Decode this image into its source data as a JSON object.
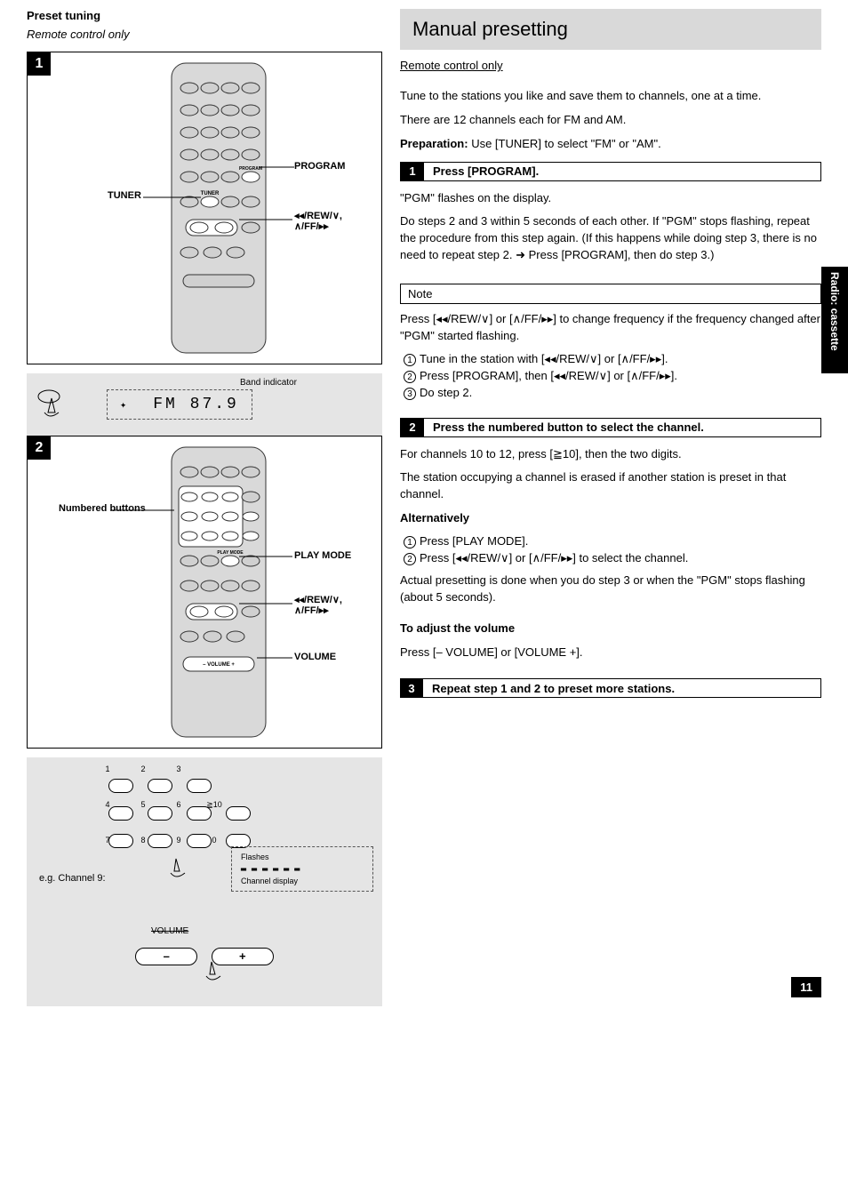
{
  "page_number": "11",
  "side_tab": "Radio: cassette",
  "left": {
    "title": "Preset tuning",
    "sub": "Remote control only",
    "step1": {
      "num": "1",
      "tuner_label": "TUNER",
      "program_label": "PROGRAM",
      "btns_label_rew": "◂◂/REW/∨,",
      "btns_label_ff": "∧/FF/▸▸",
      "band_indicator": "Band indicator",
      "display_text": "FM   87.9"
    },
    "step2": {
      "num": "2",
      "numbered_label": "Numbered buttons",
      "playmode_label": "PLAY MODE",
      "volume_label": "VOLUME",
      "btns_label_rew": "◂◂/REW/∨,",
      "btns_label_ff": "∧/FF/▸▸"
    },
    "numpad": {
      "n1": "1",
      "n2": "2",
      "n3": "3",
      "n4": "4",
      "n5": "5",
      "n6": "6",
      "n10": "≧10",
      "n7": "7",
      "n8": "8",
      "n9": "9",
      "n0": "0",
      "ex_label": "e.g. Channel 9:"
    },
    "mini_display": {
      "flashing": "Flashes",
      "channel_display": "Channel display"
    },
    "vol": {
      "minus": "–",
      "plus": "+",
      "strike": "VOLUME"
    }
  },
  "right": {
    "big_title": "Manual presetting",
    "only_remote": "Remote control only",
    "intro1": "Tune to the stations you like and save them to channels, one at a time.",
    "intro2": "There are 12 channels each for FM and AM.",
    "prep_label": "Preparation:",
    "prep_text": "Use [TUNER] to select \"FM\" or \"AM\".",
    "step_a": {
      "num": "1",
      "head": "Press [PROGRAM].",
      "body": "\"PGM\" flashes on the display.",
      "body2": "Do steps 2 and 3 within 5 seconds of each other. If \"PGM\" stops flashing, repeat the procedure from this step again. (If this happens while doing step 3, there is no need to repeat step 2. ➜ Press [PROGRAM], then do step 3.)"
    },
    "note_title": "Note",
    "note_body": "Press [◂◂/REW/∨] or [∧/FF/▸▸] to change frequency if the frequency changed after \"PGM\" started flashing.",
    "note_list1": "Tune in the station with [◂◂/REW/∨] or [∧/FF/▸▸].",
    "note_list2": "Press [PROGRAM], then [◂◂/REW/∨] or [∧/FF/▸▸].",
    "note_list3": "Do step 2.",
    "step_b": {
      "num": "2",
      "head": "Press the numbered button to select the channel.",
      "body1": "For channels 10 to 12, press [≧10], then the two digits.",
      "body2": "The station occupying a channel is erased if another station is preset in that channel.",
      "altline": "Alternatively",
      "alt1": "Press [PLAY MODE].",
      "alt2": "Press [◂◂/REW/∨] or [∧/FF/▸▸] to select the channel.",
      "body3": "Actual presetting is done when you do step 3 or when the \"PGM\" stops flashing (about 5 seconds)."
    },
    "vol_head": "To adjust the volume",
    "vol_body": "Press [– VOLUME] or [VOLUME +].",
    "step_c": {
      "num": "3",
      "head": "Repeat step 1 and 2 to preset more stations."
    }
  }
}
